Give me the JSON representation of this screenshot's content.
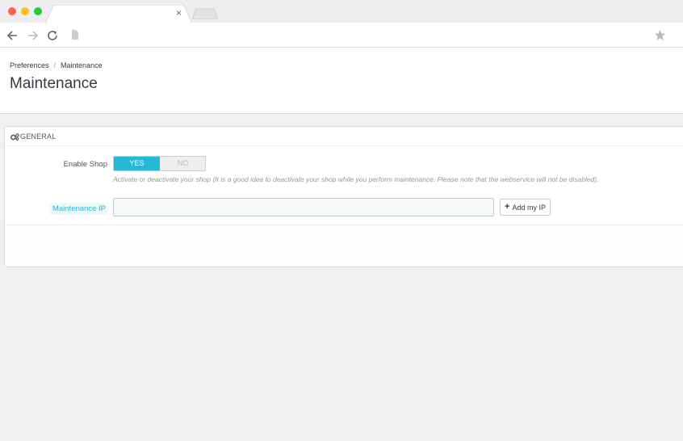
{
  "browser": {
    "traffic_lights": [
      "#ff5f57",
      "#febc2e",
      "#28c840"
    ],
    "tab_close": "×"
  },
  "breadcrumb": {
    "parent": "Preferences",
    "separator": "/",
    "current": "Maintenance"
  },
  "page": {
    "title": "Maintenance"
  },
  "panel": {
    "heading": "GENERAL",
    "heading_icon": "cogs-icon",
    "enable_shop": {
      "label": "Enable Shop",
      "yes": "YES",
      "no": "NO",
      "selected": "YES",
      "help": "Activate or deactivate your shop (It is a good idea to deactivate your shop while you perform maintenance. Please note that the webservice will not be disabled)."
    },
    "maintenance_ip": {
      "label": "Maintenance IP",
      "value": "",
      "button": "Add my IP"
    }
  },
  "colors": {
    "accent": "#25b9d7",
    "background": "#eff1f2"
  }
}
